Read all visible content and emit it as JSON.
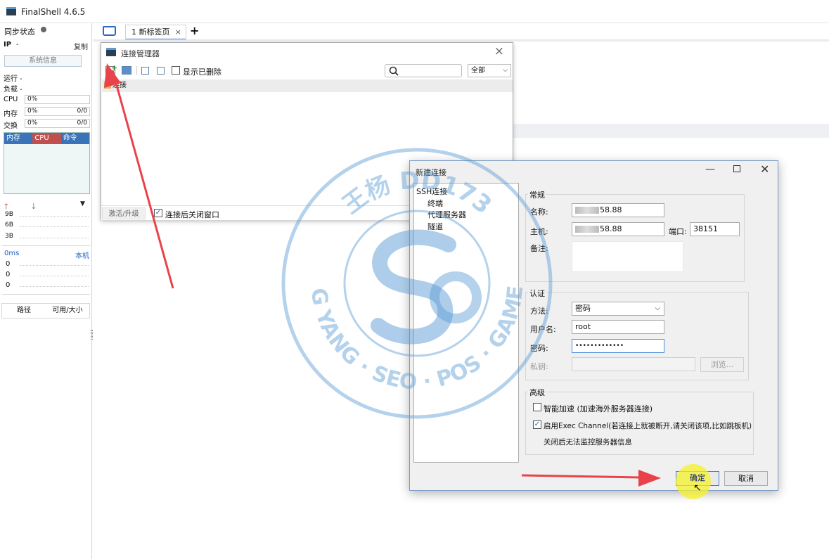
{
  "app": {
    "title": "FinalShell 4.6.5"
  },
  "sidebar": {
    "sync_label": "同步状态",
    "ip_label": "IP",
    "ip_value": "-",
    "copy_label": "复制",
    "sysinfo_button": "系统信息",
    "run_label": "运行 -",
    "load_label": "负载 -",
    "cpu": {
      "label": "CPU",
      "value": "0%"
    },
    "mem": {
      "label": "内存",
      "value": "0%",
      "ratio": "0/0"
    },
    "swap": {
      "label": "交换",
      "value": "0%",
      "ratio": "0/0"
    },
    "graph_tabs": [
      "内存",
      "CPU",
      "命令"
    ],
    "net_rows": [
      "9B",
      "6B",
      "3B"
    ],
    "latency_label": "0ms",
    "local_label": "本机",
    "latency_rows": [
      "0",
      "0",
      "0"
    ],
    "path_header": "路径",
    "size_header": "可用/大小"
  },
  "tabs": {
    "active_label": "1 新标签页",
    "close_glyph": "×",
    "add_glyph": "+"
  },
  "conn_manager": {
    "title": "连接管理器",
    "close_glyph": "×",
    "show_deleted_label": "显示已删除",
    "filter_value": "全部",
    "list_header": "连接",
    "activate_label": "激活/升级",
    "close_after_connect_label": "连接后关闭窗口"
  },
  "new_conn": {
    "title": "新建连接",
    "tree": {
      "root": "SSH连接",
      "children": [
        "终端",
        "代理服务器",
        "隧道"
      ]
    },
    "general_label": "常规",
    "name_label": "名称:",
    "name_value": "58.88",
    "host_label": "主机:",
    "host_value": "58.88",
    "port_label": "端口:",
    "port_value": "38151",
    "note_label": "备注:",
    "auth_label": "认证",
    "method_label": "方法:",
    "method_value": "密码",
    "user_label": "用户名:",
    "user_value": "root",
    "pass_label": "密码:",
    "pass_value": "•••••••••••••",
    "key_label": "私钥:",
    "browse_label": "浏览...",
    "advanced_label": "高级",
    "accel_label": "智能加速 (加速海外服务器连接)",
    "exec_label": "启用Exec Channel(若连接上就被断开,请关闭该项,比如跳板机)",
    "exec_note": "关闭后无法监控服务器信息",
    "ok_label": "确定",
    "cancel_label": "取消"
  },
  "watermark": {
    "top_text": "王杨 DD173",
    "bottom_text": "WANG YANG · SEO · POS · GAME CPS",
    "color": "#5b9bd5"
  },
  "colors": {
    "accent": "#3b7ad9",
    "arrow": "#e8434a",
    "graph_mem": "#3a73b8",
    "graph_cpu": "#c0504d",
    "graph_cmd": "#3a73b8",
    "highlight": "#f5f22a"
  }
}
